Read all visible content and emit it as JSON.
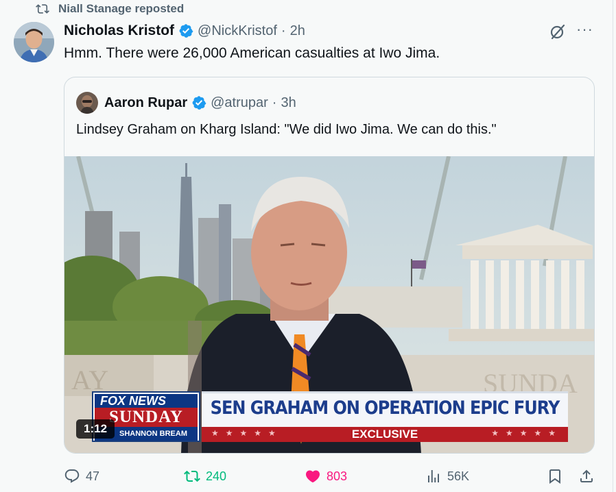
{
  "repost": {
    "label": "Niall Stanage reposted"
  },
  "tweet": {
    "author_name": "Nicholas Kristof",
    "author_handle": "@NickKristof",
    "separator": "·",
    "time": "2h",
    "text": "Hmm. There were 26,000 American casualties at Iwo Jima.",
    "more_label": "···"
  },
  "quote": {
    "author_name": "Aaron Rupar",
    "author_handle": "@atrupar",
    "separator": "·",
    "time": "3h",
    "text": "Lindsey Graham on Kharg Island: \"We did Iwo Jima. We can do this.\"",
    "video": {
      "duration": "1:12",
      "logo_top": "FOX NEWS",
      "logo_mid": "SUNDAY",
      "logo_bottom": "SHANNON BREAM",
      "banner": "SEN GRAHAM ON OPERATION EPIC FURY",
      "subbanner": "EXCLUSIVE",
      "stars": "★★★★★"
    }
  },
  "actions": {
    "replies": "47",
    "reposts": "240",
    "likes": "803",
    "views": "56K"
  },
  "colors": {
    "verified": "#1d9bf0",
    "retweet_active": "#00ba7c",
    "like_active": "#f91880",
    "muted": "#536471"
  }
}
